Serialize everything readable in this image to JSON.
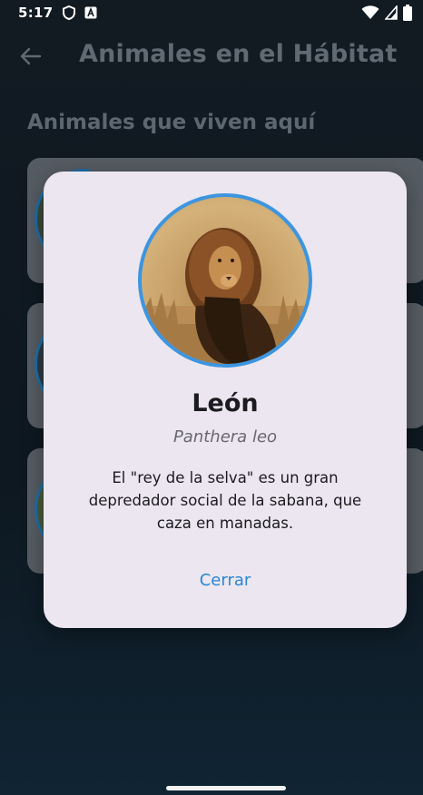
{
  "status_bar": {
    "time": "5:17",
    "icons": [
      "shield-icon",
      "text-a-icon",
      "wifi-icon",
      "signal-icon",
      "battery-icon"
    ]
  },
  "app_bar": {
    "title": "Animales en el Hábitat",
    "back_icon": "arrow-left-icon"
  },
  "section": {
    "title": "Animales que viven aquí"
  },
  "dialog": {
    "animal_name": "León",
    "scientific_name": "Panthera leo",
    "description": "El \"rey de la selva\" es un gran depredador social de la sabana, que caza en manadas.",
    "close_label": "Cerrar",
    "photo_icon": "lion-photo",
    "accent_color": "#3d95e0"
  },
  "colors": {
    "background": "#121a22",
    "dialog_background": "#ebe6ef",
    "link": "#2a86d6"
  }
}
